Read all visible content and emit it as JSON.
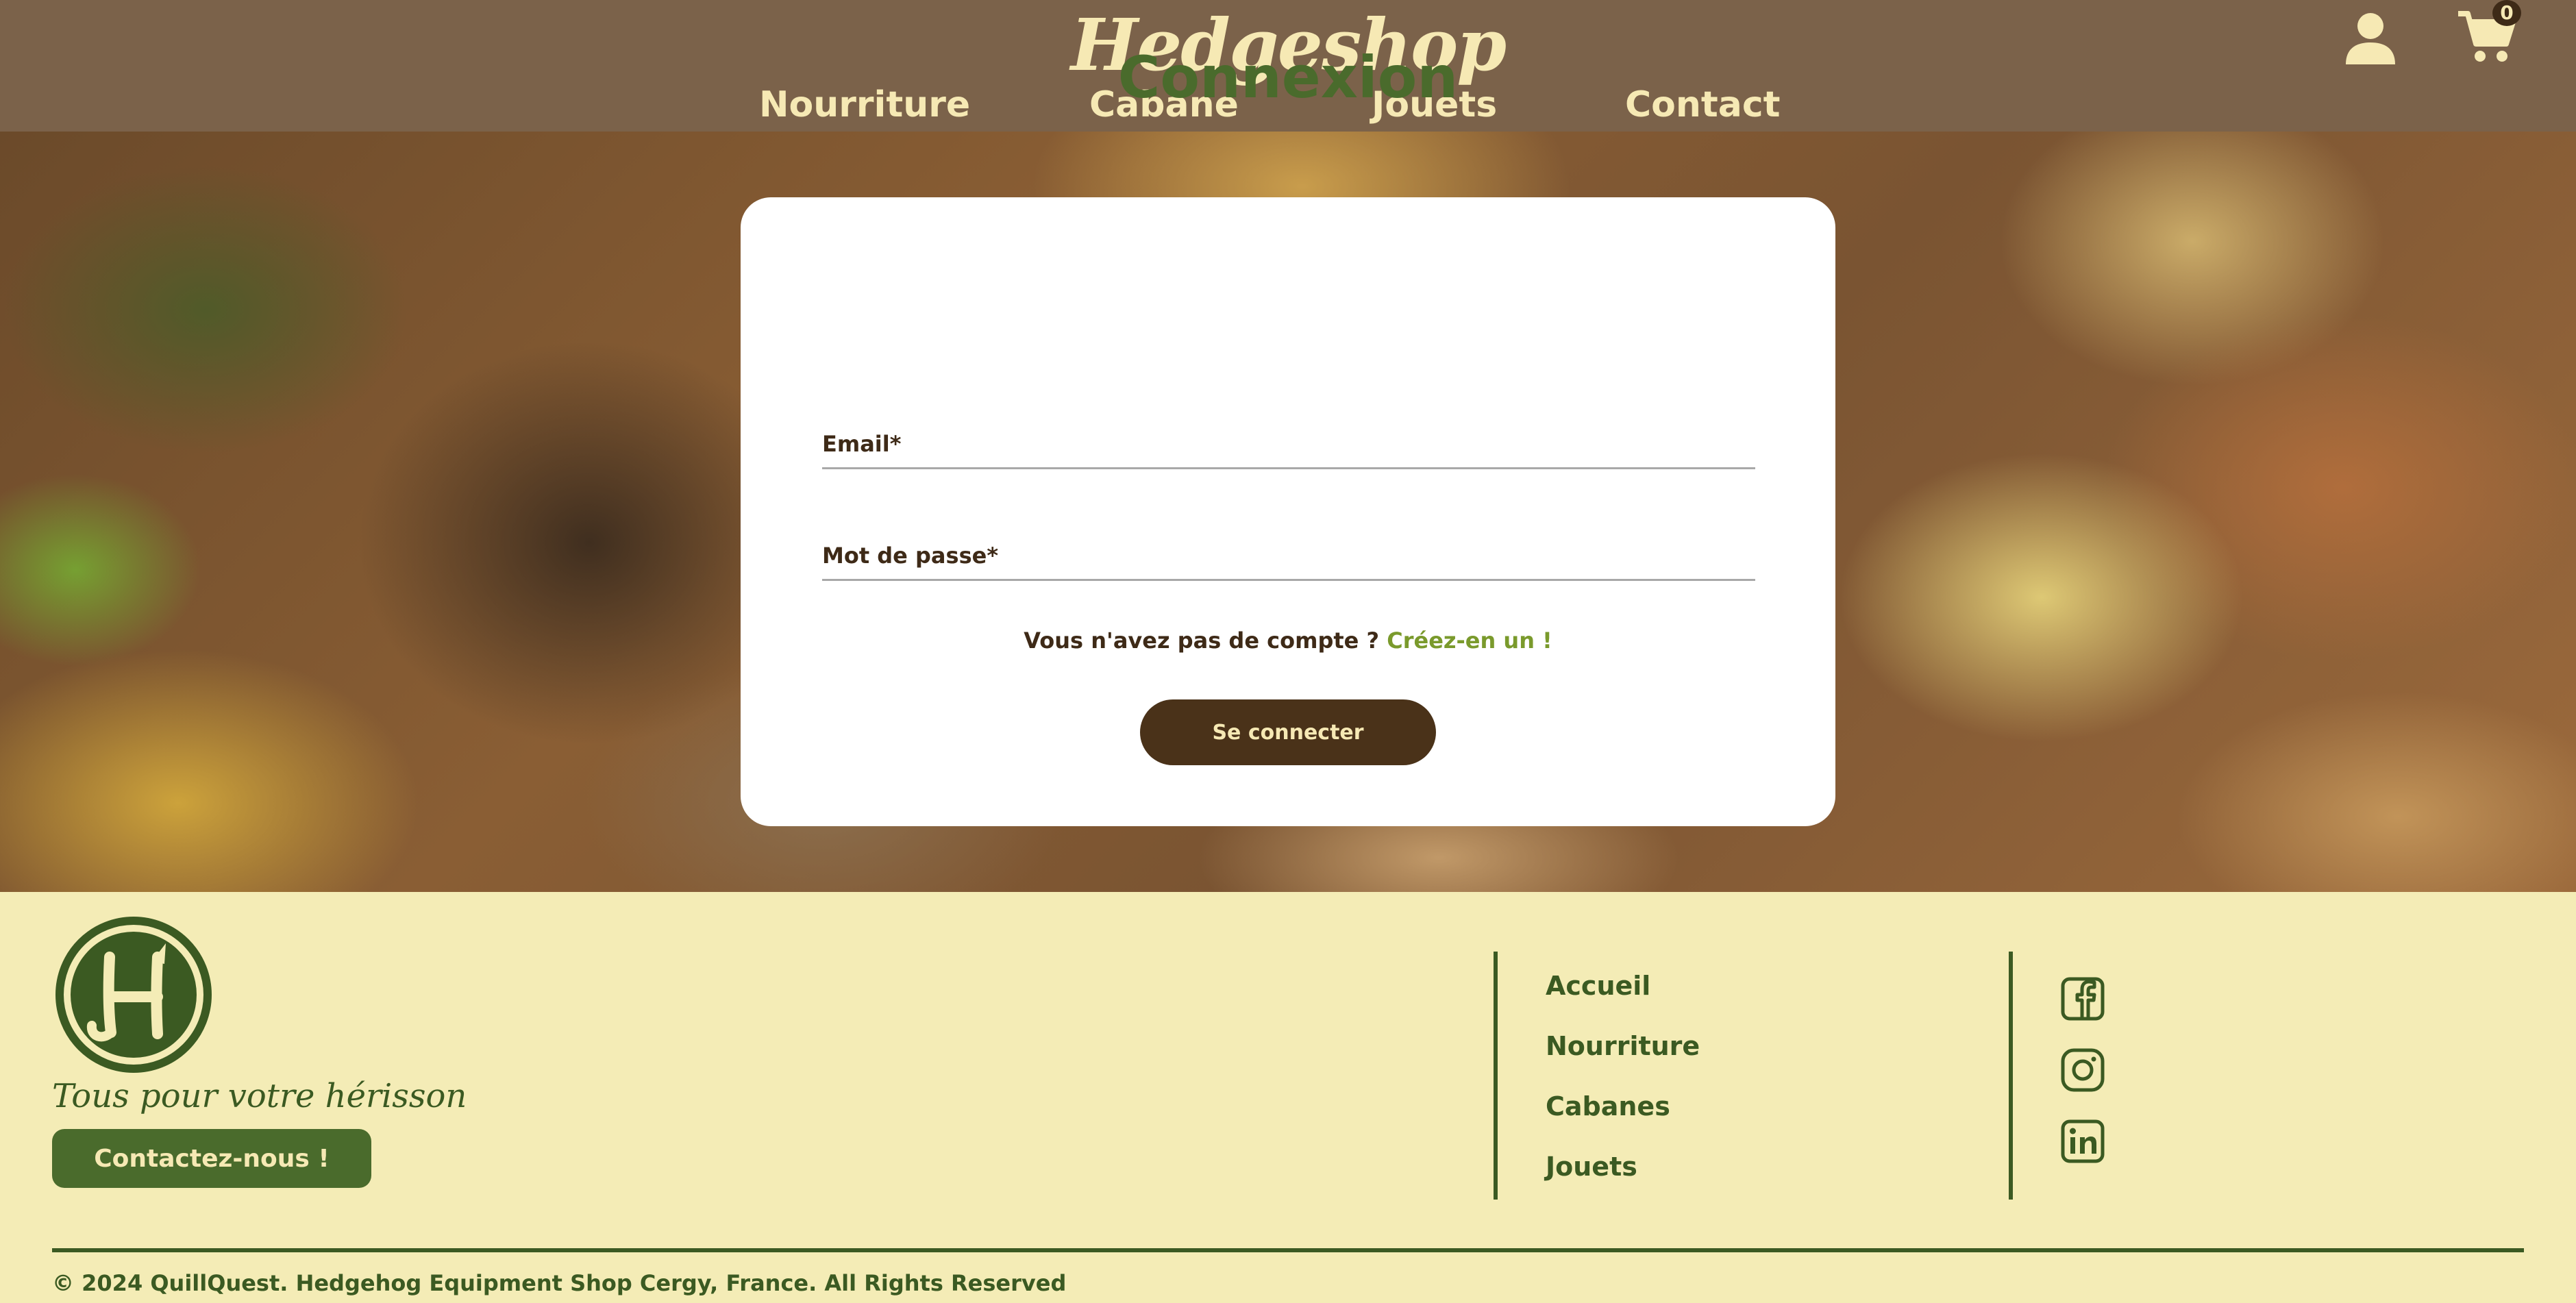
{
  "header": {
    "logo_text": "Hedgeshop",
    "nav": [
      {
        "label": "Nourriture"
      },
      {
        "label": "Cabane"
      },
      {
        "label": "Jouets"
      },
      {
        "label": "Contact"
      }
    ],
    "account_icon": "user-icon",
    "cart_icon": "cart-icon",
    "cart_count": "0"
  },
  "login": {
    "title": "Connexion",
    "email_label": "Email*",
    "email_value": "",
    "password_label": "Mot de passe*",
    "password_value": "",
    "no_account_text": "Vous n'avez pas de compte ?",
    "signup_link": "Créez-en un !",
    "submit_label": "Se connecter"
  },
  "footer": {
    "tagline": "Tous pour votre hérisson",
    "contact_button": "Contactez-nous !",
    "links": [
      {
        "label": "Accueil"
      },
      {
        "label": "Nourriture"
      },
      {
        "label": "Cabanes"
      },
      {
        "label": "Jouets"
      }
    ],
    "social": [
      {
        "icon": "facebook-icon"
      },
      {
        "icon": "instagram-icon"
      },
      {
        "icon": "linkedin-icon"
      }
    ],
    "copyright": "© 2024 QuillQuest. Hedgehog Equipment Shop Cergy, France. All Rights Reserved"
  },
  "colors": {
    "header_bg": "#7b624a",
    "header_text": "#f6e9b4",
    "accent_green": "#4a6b2c",
    "button_brown": "#4a3219",
    "link_green": "#7a9a2c",
    "footer_bg": "#f4ecb6"
  }
}
